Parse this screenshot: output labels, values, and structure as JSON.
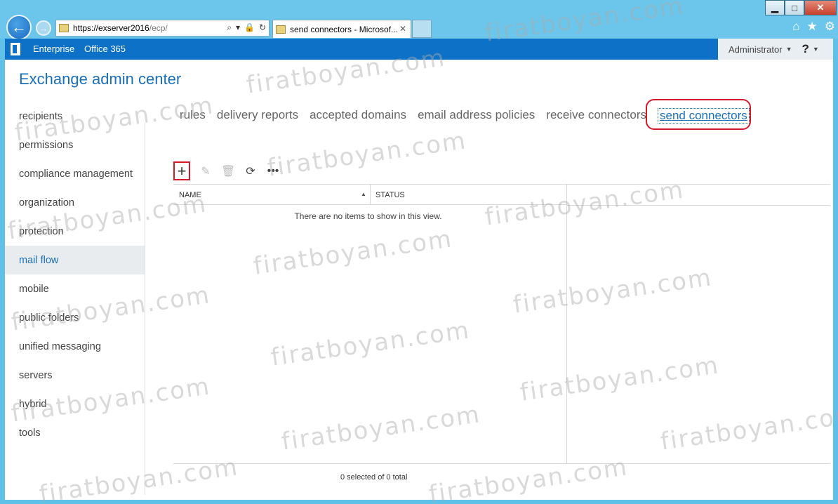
{
  "browser": {
    "url_host": "https://exserver2016",
    "url_path": "/ecp/",
    "tab_title": "send connectors - Microsof..."
  },
  "topbar": {
    "links": [
      "Enterprise",
      "Office 365"
    ],
    "user": "Administrator",
    "help": "?"
  },
  "app_title": "Exchange admin center",
  "leftnav": {
    "items": [
      "recipients",
      "permissions",
      "compliance management",
      "organization",
      "protection",
      "mail flow",
      "mobile",
      "public folders",
      "unified messaging",
      "servers",
      "hybrid",
      "tools"
    ],
    "active": "mail flow"
  },
  "subtabs": {
    "items": [
      "rules",
      "delivery reports",
      "accepted domains",
      "email address policies",
      "receive connectors",
      "send connectors"
    ],
    "active": "send connectors"
  },
  "grid": {
    "columns": [
      "NAME",
      "STATUS"
    ],
    "empty_message": "There are no items to show in this view.",
    "selection_status": "0 selected of 0 total"
  },
  "watermark": "firatboyan.com",
  "colors": {
    "accent": "#0d72c7",
    "highlight": "#d4192a"
  }
}
